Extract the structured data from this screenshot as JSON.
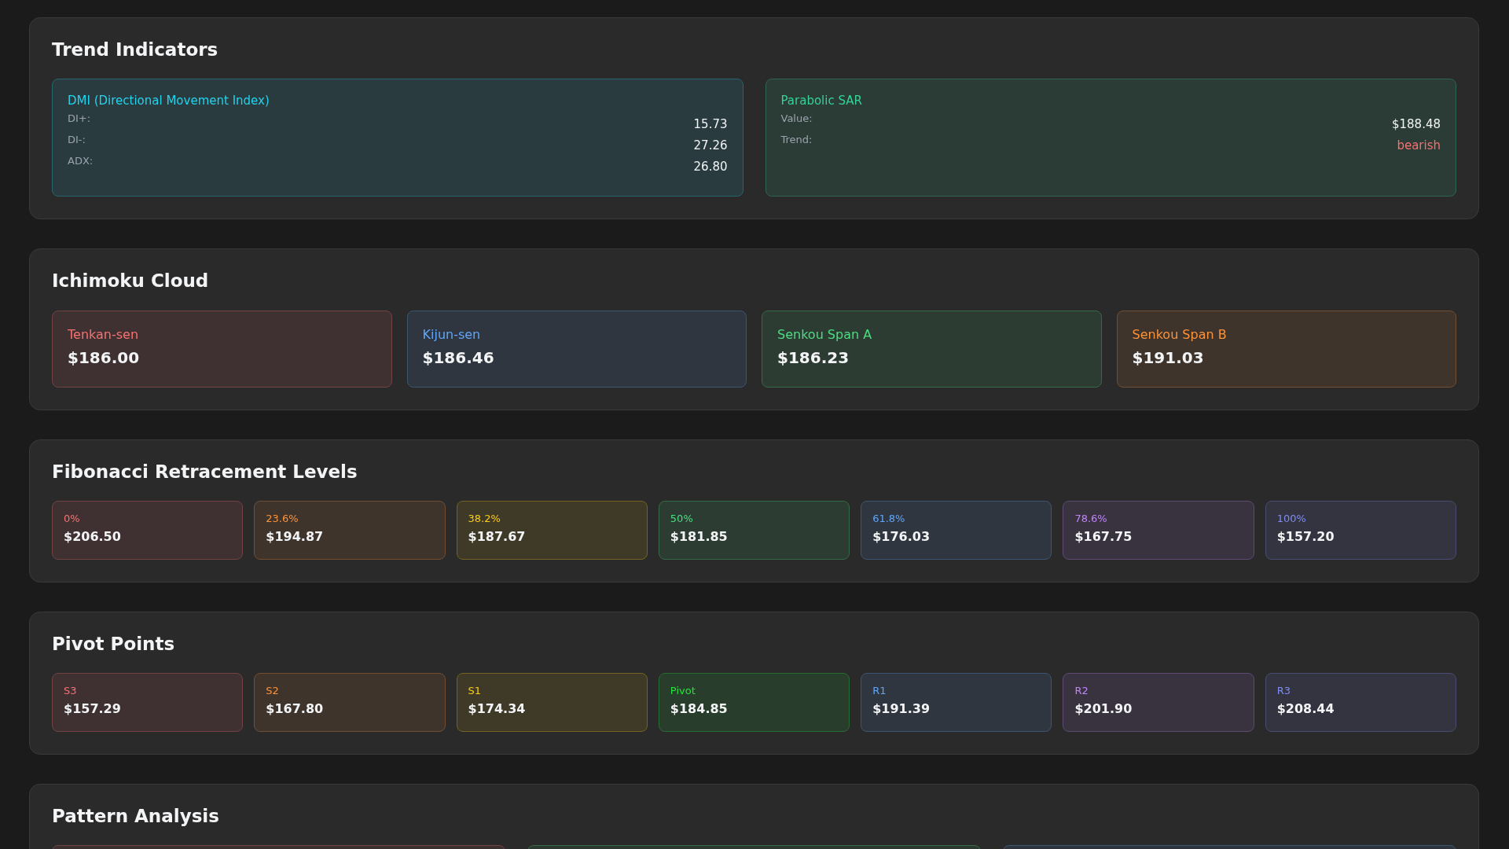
{
  "trend_indicators": {
    "title": "Trend Indicators",
    "cards": [
      {
        "title": "DMI (Directional Movement Index)",
        "color": "#22d3ee",
        "rows": [
          {
            "label": "DI+:",
            "value": "15.73"
          },
          {
            "label": "DI-:",
            "value": "27.26"
          },
          {
            "label": "ADX:",
            "value": "26.80"
          }
        ]
      },
      {
        "title": "Parabolic SAR",
        "color": "#34d399",
        "rows": [
          {
            "label": "Value:",
            "value": "$188.48"
          },
          {
            "label": "Trend:",
            "value": "bearish",
            "color": "#f87171"
          }
        ]
      }
    ]
  },
  "ichimoku": {
    "title": "Ichimoku Cloud",
    "items": [
      {
        "label": "Tenkan-sen",
        "value": "$186.00",
        "color": "#f87171"
      },
      {
        "label": "Kijun-sen",
        "value": "$186.46",
        "color": "#60a5fa"
      },
      {
        "label": "Senkou Span A",
        "value": "$186.23",
        "color": "#4ade80"
      },
      {
        "label": "Senkou Span B",
        "value": "$191.03",
        "color": "#fb923c"
      }
    ]
  },
  "fibonacci": {
    "title": "Fibonacci Retracement Levels",
    "items": [
      {
        "label": "0%",
        "value": "$206.50",
        "color": "#f87171"
      },
      {
        "label": "23.6%",
        "value": "$194.87",
        "color": "#fb923c"
      },
      {
        "label": "38.2%",
        "value": "$187.67",
        "color": "#facc15"
      },
      {
        "label": "50%",
        "value": "$181.85",
        "color": "#4ade80"
      },
      {
        "label": "61.8%",
        "value": "$176.03",
        "color": "#60a5fa"
      },
      {
        "label": "78.6%",
        "value": "$167.75",
        "color": "#c084fc"
      },
      {
        "label": "100%",
        "value": "$157.20",
        "color": "#818cf8"
      }
    ]
  },
  "pivot_points": {
    "title": "Pivot Points",
    "items": [
      {
        "label": "S3",
        "value": "$157.29",
        "color": "#f87171"
      },
      {
        "label": "S2",
        "value": "$167.80",
        "color": "#fb923c"
      },
      {
        "label": "S1",
        "value": "$174.34",
        "color": "#facc15"
      },
      {
        "label": "Pivot",
        "value": "$184.85",
        "color": "#22e63a"
      },
      {
        "label": "R1",
        "value": "$191.39",
        "color": "#60a5fa"
      },
      {
        "label": "R2",
        "value": "$201.90",
        "color": "#c084fc"
      },
      {
        "label": "R3",
        "value": "$208.44",
        "color": "#818cf8"
      }
    ]
  },
  "pattern_analysis": {
    "title": "Pattern Analysis",
    "cards": [
      {
        "color": "#724343"
      },
      {
        "color": "#356948"
      },
      {
        "color": "#3d5573"
      }
    ]
  }
}
